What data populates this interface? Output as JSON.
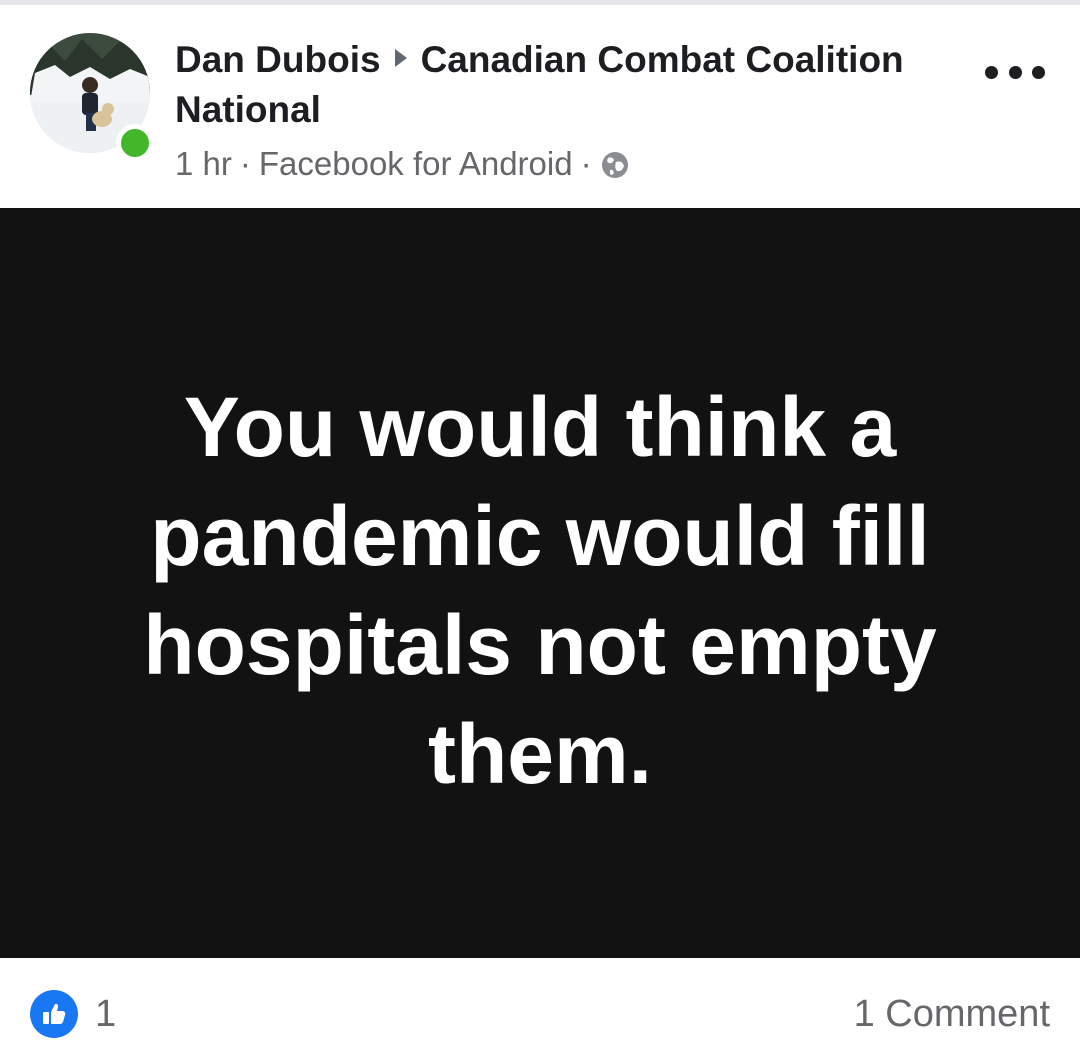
{
  "post": {
    "author": "Dan Dubois",
    "group": "Canadian Combat Coalition National",
    "time": "1 hr",
    "source": "Facebook for Android",
    "separator": "·",
    "privacy_icon": "globe-icon",
    "more_icon": "more-options-icon",
    "text": "You would think a pandemic would fill hospitals not empty them.",
    "image_background": "#121212",
    "text_color": "#ffffff"
  },
  "footer": {
    "reaction_icon": "like-icon",
    "reaction_color": "#1877f2",
    "reaction_count": "1",
    "comment_count": "1 Comment"
  },
  "status": {
    "online_color": "#42b72a"
  }
}
